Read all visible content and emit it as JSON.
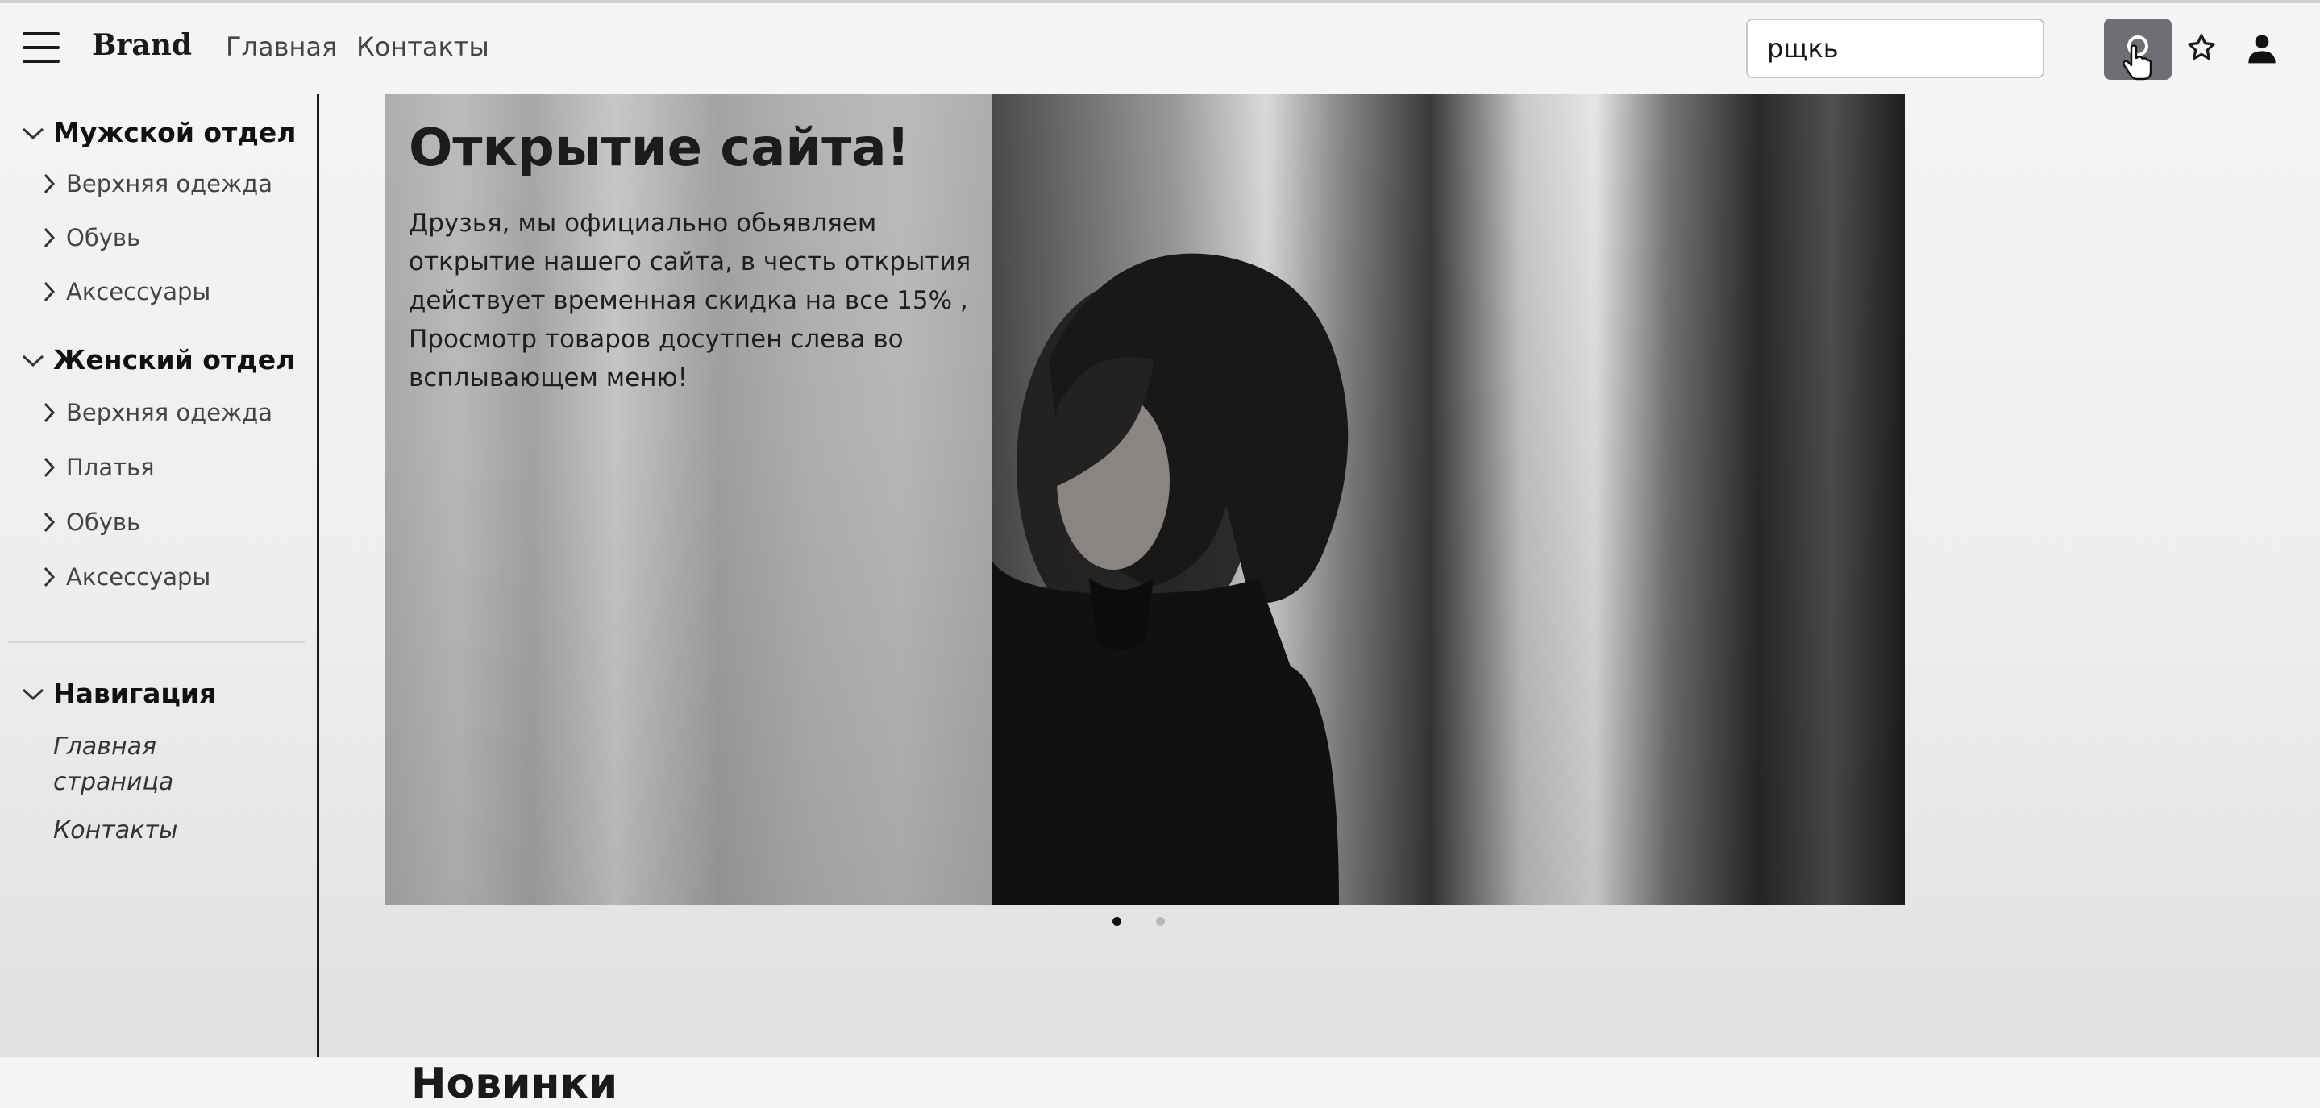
{
  "header": {
    "brand": "Brand",
    "links": [
      "Главная",
      "Контакты"
    ],
    "search_value": "рщкь",
    "icons": [
      "hamburger-menu-icon",
      "search-icon",
      "star-icon",
      "user-icon"
    ]
  },
  "sidebar": {
    "men": {
      "title": "Мужской отдел",
      "items": [
        "Верхняя одежда",
        "Обувь",
        "Аксессуары"
      ]
    },
    "women": {
      "title": "Женский отдел",
      "items": [
        "Верхняя одежда",
        "Платья",
        "Обувь",
        "Аксессуары"
      ]
    },
    "navigation": {
      "title": "Навигация",
      "links": [
        "Главная страница",
        "Контакты"
      ]
    }
  },
  "carousel": {
    "title": "Открытие сайта!",
    "text": "Друзья, мы официально обьявляем открытие нашего сайта, в честь открытия действует временная скидка на все 15% , Просмотр товаров досутпен слева во всплывающем меню!",
    "slide_count": 2,
    "active_index": 0
  },
  "main": {
    "section_title": "Новинки"
  },
  "colors": {
    "navbar_bg": "#f4f4f6",
    "search_button_bg": "#6e6e74",
    "text": "#1a1a1a",
    "dot_active": "#111111",
    "dot_inactive": "#b8b8b8"
  }
}
